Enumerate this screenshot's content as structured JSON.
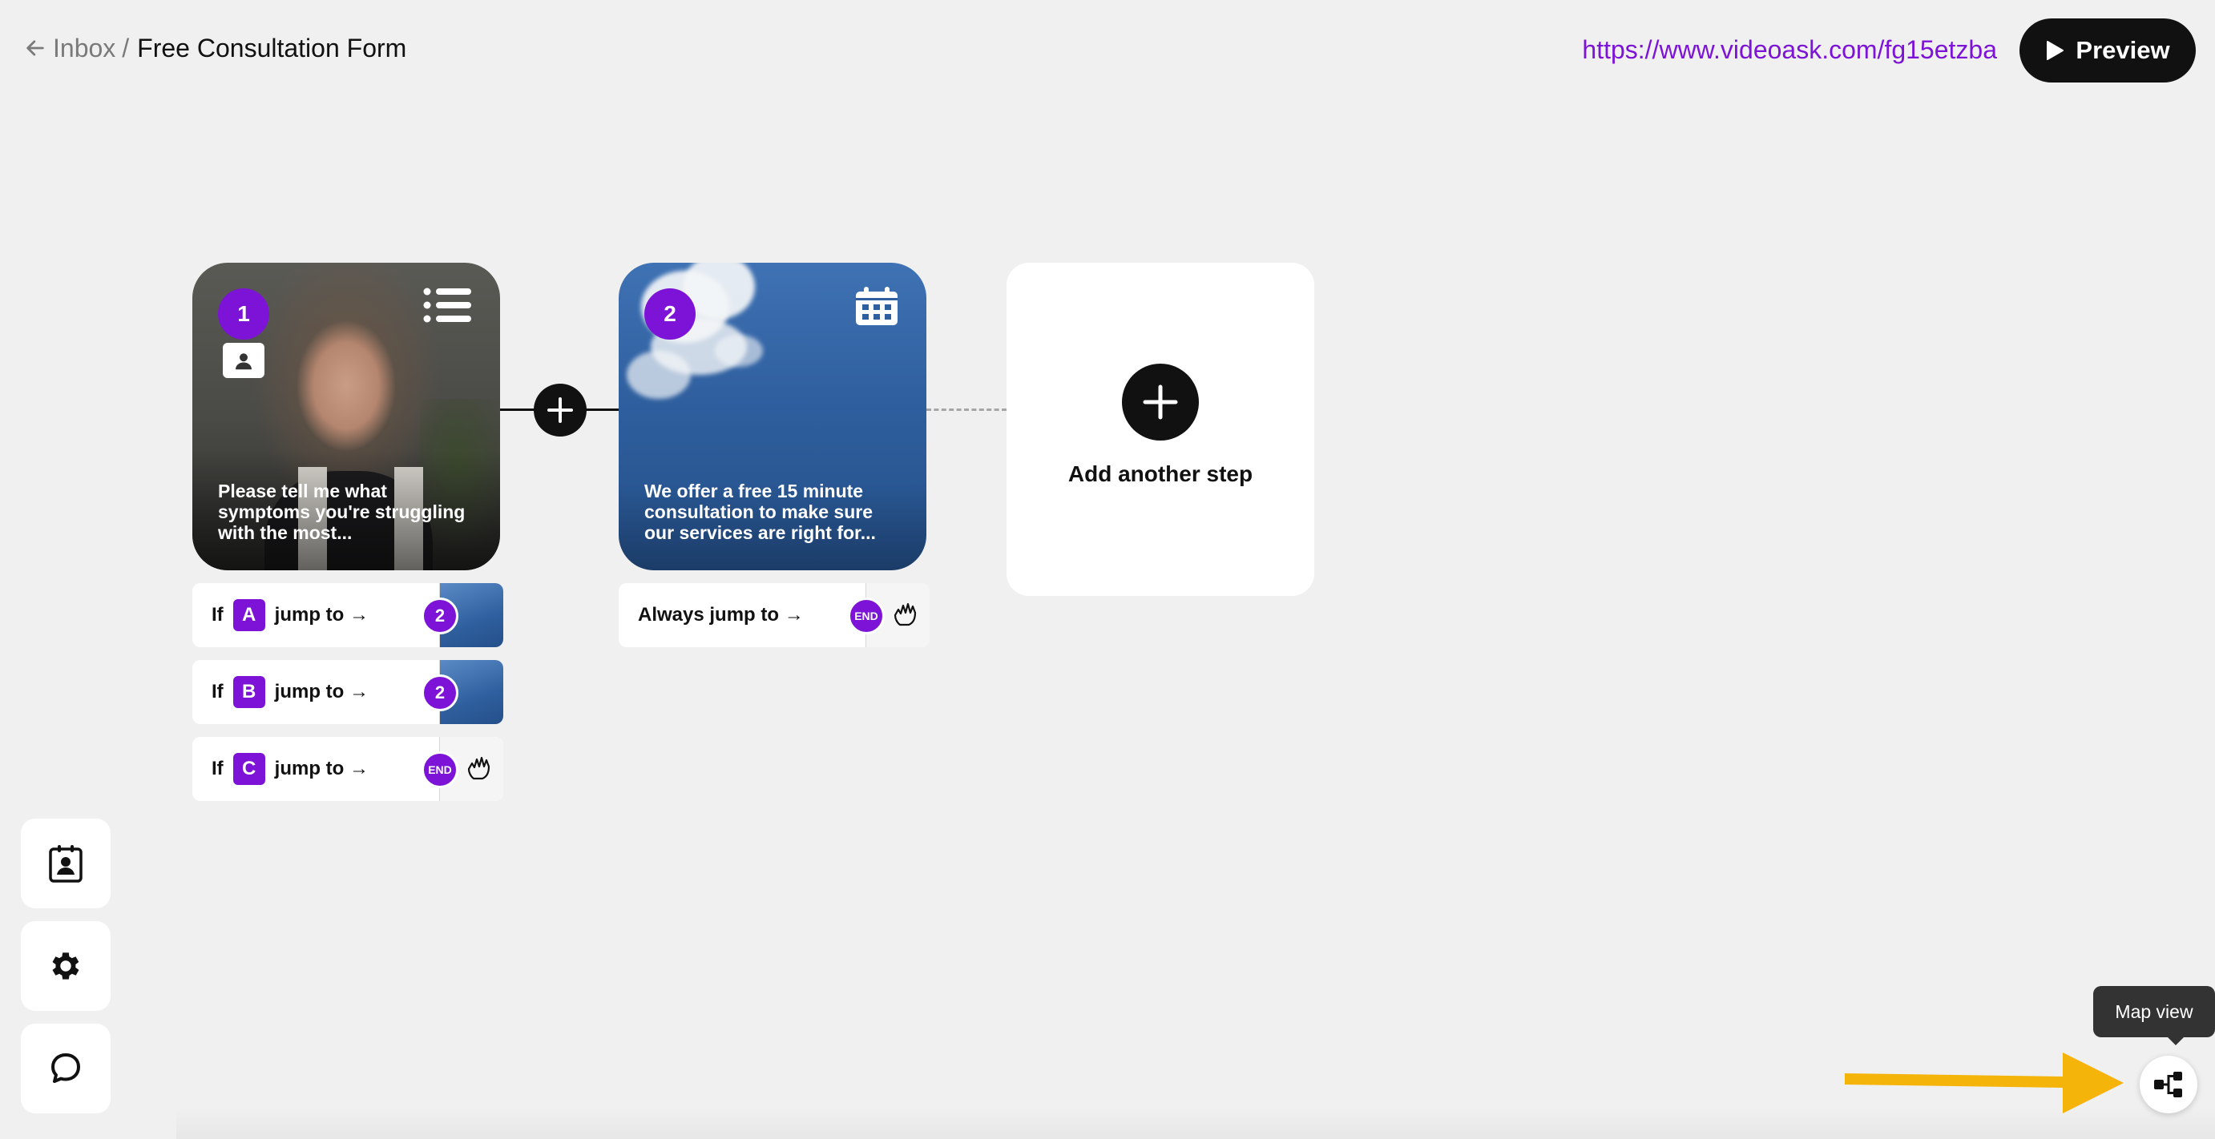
{
  "header": {
    "back_label": "Inbox",
    "separator": "/",
    "form_title": "Free Consultation Form",
    "share_url": "https://www.videoask.com/fg15etzba",
    "preview_label": "Preview"
  },
  "steps": [
    {
      "number": "1",
      "type_icon": "list-icon",
      "extra_icon": "contact-card-icon",
      "caption": "Please tell me what symptoms you're struggling with the most...",
      "rules": [
        {
          "prefix": "If",
          "letter": "A",
          "action": "jump to →",
          "destination": "2"
        },
        {
          "prefix": "If",
          "letter": "B",
          "action": "jump to →",
          "destination": "2"
        },
        {
          "prefix": "If",
          "letter": "C",
          "action": "jump to →",
          "destination": "END"
        }
      ]
    },
    {
      "number": "2",
      "type_icon": "calendar-icon",
      "caption": "We offer a free 15 minute consultation to make sure our services are right for...",
      "rules": [
        {
          "action": "Always jump to →",
          "destination": "END"
        }
      ]
    }
  ],
  "add_step": {
    "label": "Add another step"
  },
  "sidebar": [
    {
      "icon": "contact-book-icon"
    },
    {
      "icon": "gear-icon"
    },
    {
      "icon": "chat-bubble-icon"
    }
  ],
  "map_view": {
    "tooltip": "Map view",
    "icon": "map-view-icon"
  },
  "colors": {
    "accent": "#7c13d6",
    "background": "#f0f0f0",
    "dark": "#111111",
    "annotation_arrow": "#f5b40a"
  }
}
